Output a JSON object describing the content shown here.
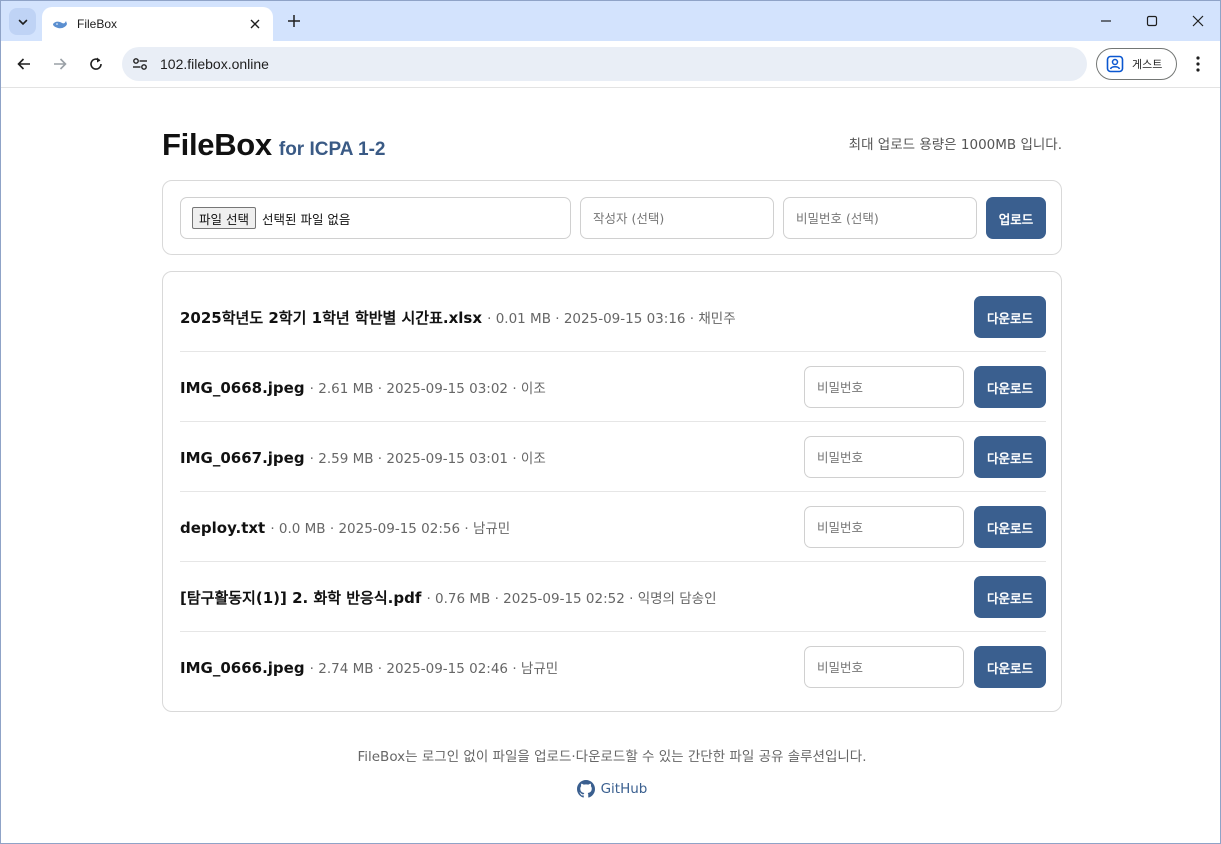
{
  "browser": {
    "tab_title": "FileBox",
    "url": "102.filebox.online",
    "profile_label": "게스트"
  },
  "header": {
    "brand": "FileBox",
    "subtitle": "for ICPA 1-2",
    "quota_text": "최대 업로드 용량은 1000MB 입니다."
  },
  "upload": {
    "choose_file_label": "파일 선택",
    "no_file_text": "선택된 파일 없음",
    "author_placeholder": "작성자 (선택)",
    "password_placeholder": "비밀번호 (선택)",
    "upload_label": "업로드"
  },
  "files": [
    {
      "name": "2025학년도 2학기 1학년 학반별 시간표.xlsx",
      "meta": "· 0.01 MB · 2025-09-15 03:16 · 채민주",
      "locked": false
    },
    {
      "name": "IMG_0668.jpeg",
      "meta": "· 2.61 MB · 2025-09-15 03:02 · 이조",
      "locked": true
    },
    {
      "name": "IMG_0667.jpeg",
      "meta": "· 2.59 MB · 2025-09-15 03:01 · 이조",
      "locked": true
    },
    {
      "name": "deploy.txt",
      "meta": "· 0.0 MB · 2025-09-15 02:56 · 남규민",
      "locked": true
    },
    {
      "name": "[탐구활동지(1)] 2. 화학 반응식.pdf",
      "meta": "· 0.76 MB · 2025-09-15 02:52 · 익명의 담송인",
      "locked": false
    },
    {
      "name": "IMG_0666.jpeg",
      "meta": "· 2.74 MB · 2025-09-15 02:46 · 남규민",
      "locked": true
    }
  ],
  "row_labels": {
    "password_placeholder": "비밀번호",
    "download_label": "다운로드"
  },
  "footer": {
    "description": "FileBox는 로그인 없이 파일을 업로드·다운로드할 수 있는 간단한 파일 공유 솔루션입니다.",
    "github_label": "GitHub"
  },
  "colors": {
    "accent": "#3a5f8f",
    "subtitle": "#3a5a85",
    "browser_frame": "#d3e3fd"
  }
}
